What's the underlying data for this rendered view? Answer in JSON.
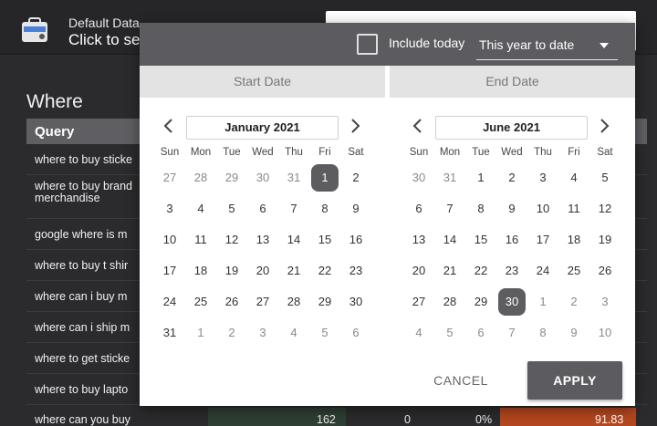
{
  "topbar": {
    "data_source_title": "Default Data",
    "data_source_subtitle": "Click to se"
  },
  "report": {
    "heading": "Where",
    "table": {
      "header": "Query",
      "rows": [
        "where to buy sticke",
        "where to buy brand merchandise",
        "google where is m",
        "where to buy t shir",
        "where can i buy m",
        "where can i ship m",
        "where to get sticke",
        "where to buy lapto"
      ],
      "last_row": {
        "query": "where can you buy",
        "value1": "162",
        "value2": "0",
        "value3": "0%",
        "value4": "91.83"
      }
    }
  },
  "picker": {
    "include_today_label": "Include today",
    "range_value": "This year to date",
    "start_tab": "Start Date",
    "end_tab": "End Date",
    "weekdays": [
      "Sun",
      "Mon",
      "Tue",
      "Wed",
      "Thu",
      "Fri",
      "Sat"
    ],
    "left": {
      "month": "January 2021",
      "days": [
        "27",
        "28",
        "29",
        "30",
        "31",
        "1",
        "2",
        "3",
        "4",
        "5",
        "6",
        "7",
        "8",
        "9",
        "10",
        "11",
        "12",
        "13",
        "14",
        "15",
        "16",
        "17",
        "18",
        "19",
        "20",
        "21",
        "22",
        "23",
        "24",
        "25",
        "26",
        "27",
        "28",
        "29",
        "30",
        "31",
        "1",
        "2",
        "3",
        "4",
        "5",
        "6"
      ]
    },
    "right": {
      "month": "June 2021",
      "days": [
        "30",
        "31",
        "1",
        "2",
        "3",
        "4",
        "5",
        "6",
        "7",
        "8",
        "9",
        "10",
        "11",
        "12",
        "13",
        "14",
        "15",
        "16",
        "17",
        "18",
        "19",
        "20",
        "21",
        "22",
        "23",
        "24",
        "25",
        "26",
        "27",
        "28",
        "29",
        "30",
        "1",
        "2",
        "3",
        "4",
        "5",
        "6",
        "7",
        "8",
        "9",
        "10"
      ]
    },
    "cancel_label": "CANCEL",
    "apply_label": "APPLY"
  },
  "colors": {
    "selected_day_bg": "#5d5d60",
    "header_bg": "#5c5c60",
    "accent_orange": "#b4471f",
    "accent_green": "#2f3f34"
  }
}
